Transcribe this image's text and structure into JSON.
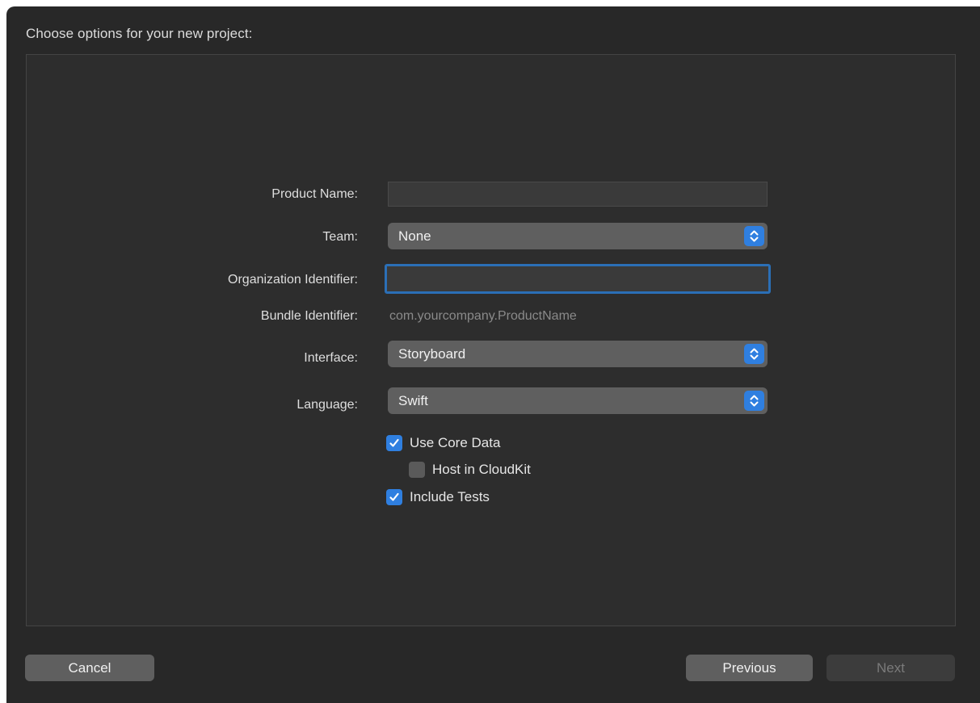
{
  "header": {
    "title": "Choose options for your new project:"
  },
  "form": {
    "product_name": {
      "label": "Product Name:",
      "value": "",
      "placeholder": ""
    },
    "team": {
      "label": "Team:",
      "selected": "None"
    },
    "organization_identifier": {
      "label": "Organization Identifier:",
      "value": "",
      "placeholder": ""
    },
    "bundle_identifier": {
      "label": "Bundle Identifier:",
      "value": "com.yourcompany.ProductName"
    },
    "interface": {
      "label": "Interface:",
      "selected": "Storyboard"
    },
    "language": {
      "label": "Language:",
      "selected": "Swift"
    },
    "checkboxes": {
      "use_core_data": {
        "label": "Use Core Data",
        "checked": true
      },
      "host_in_cloudkit": {
        "label": "Host in CloudKit",
        "checked": false
      },
      "include_tests": {
        "label": "Include Tests",
        "checked": true
      }
    }
  },
  "footer": {
    "cancel_label": "Cancel",
    "previous_label": "Previous",
    "next_label": "Next"
  },
  "colors": {
    "accent": "#2f7fe0",
    "focus_ring": "#2b6fb6",
    "window_bg": "#282828"
  },
  "icons": {
    "popup_indicator": "up-down-chevron-icon",
    "checkmark": "checkmark-icon"
  }
}
